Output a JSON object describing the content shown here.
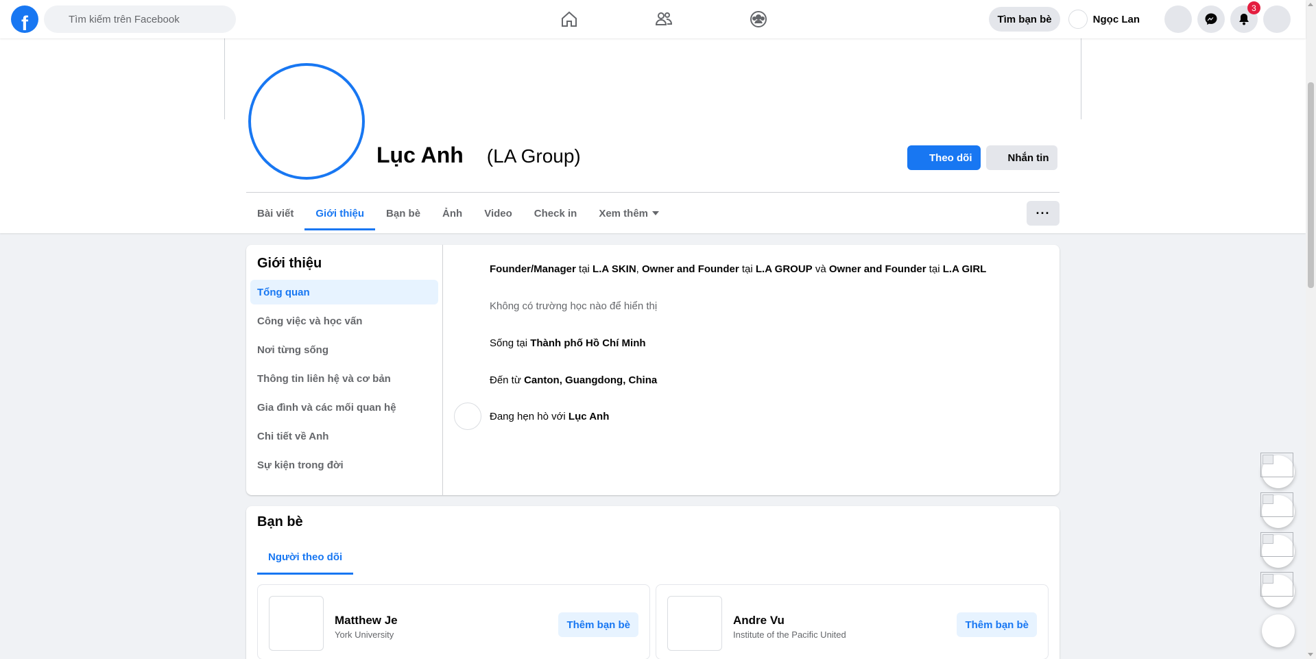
{
  "topbar": {
    "logo_letter": "f",
    "search_placeholder": "Tìm kiếm trên Facebook",
    "find_friends": "Tìm bạn bè",
    "user_name": "Ngọc Lan",
    "notification_count": "3"
  },
  "profile": {
    "name": "Lục Anh",
    "alt_name": "(LA Group)",
    "follow_label": "Theo dõi",
    "message_label": "Nhắn tin"
  },
  "tabs": [
    "Bài viết",
    "Giới thiệu",
    "Bạn bè",
    "Ảnh",
    "Video",
    "Check in",
    "Xem thêm"
  ],
  "more_label": "···",
  "about": {
    "title": "Giới thiệu",
    "sidebar": [
      "Tổng quan",
      "Công việc và học vấn",
      "Nơi từng sống",
      "Thông tin liên hệ và cơ bản",
      "Gia đình và các mối quan hệ",
      "Chi tiết về Anh",
      "Sự kiện trong đời"
    ],
    "work": {
      "role1": "Founder/Manager",
      "at1": " tại ",
      "company1": "L.A SKIN",
      "sep1": ", ",
      "role2": "Owner and Founder",
      "at2": " tại ",
      "company2": "L.A GROUP",
      "and": " và ",
      "role3": "Owner and Founder",
      "at3": " tại ",
      "company3": "L.A GIRL"
    },
    "education": "Không có trường học nào để hiển thị",
    "lives_prefix": "Sống tại ",
    "lives_city": "Thành phố Hồ Chí Minh",
    "from_prefix": "Đến từ ",
    "from_city": "Canton, Guangdong, China",
    "dating_prefix": "Đang hẹn hò với ",
    "dating_name": "Lục Anh"
  },
  "friends": {
    "title": "Bạn bè",
    "tab": "Người theo dõi",
    "items": [
      {
        "name": "Matthew Je",
        "sub": "York University",
        "action": "Thêm bạn bè"
      },
      {
        "name": "Andre Vu",
        "sub": "Institute of the Pacific United",
        "action": "Thêm bạn bè"
      }
    ]
  },
  "colors": {
    "accent": "#1877f2",
    "badge": "#e41e3f"
  },
  "icons": [
    "home-icon",
    "friends-icon",
    "groups-icon",
    "grid-menu-icon",
    "messenger-icon",
    "bell-icon",
    "account-icon",
    "search-icon"
  ]
}
